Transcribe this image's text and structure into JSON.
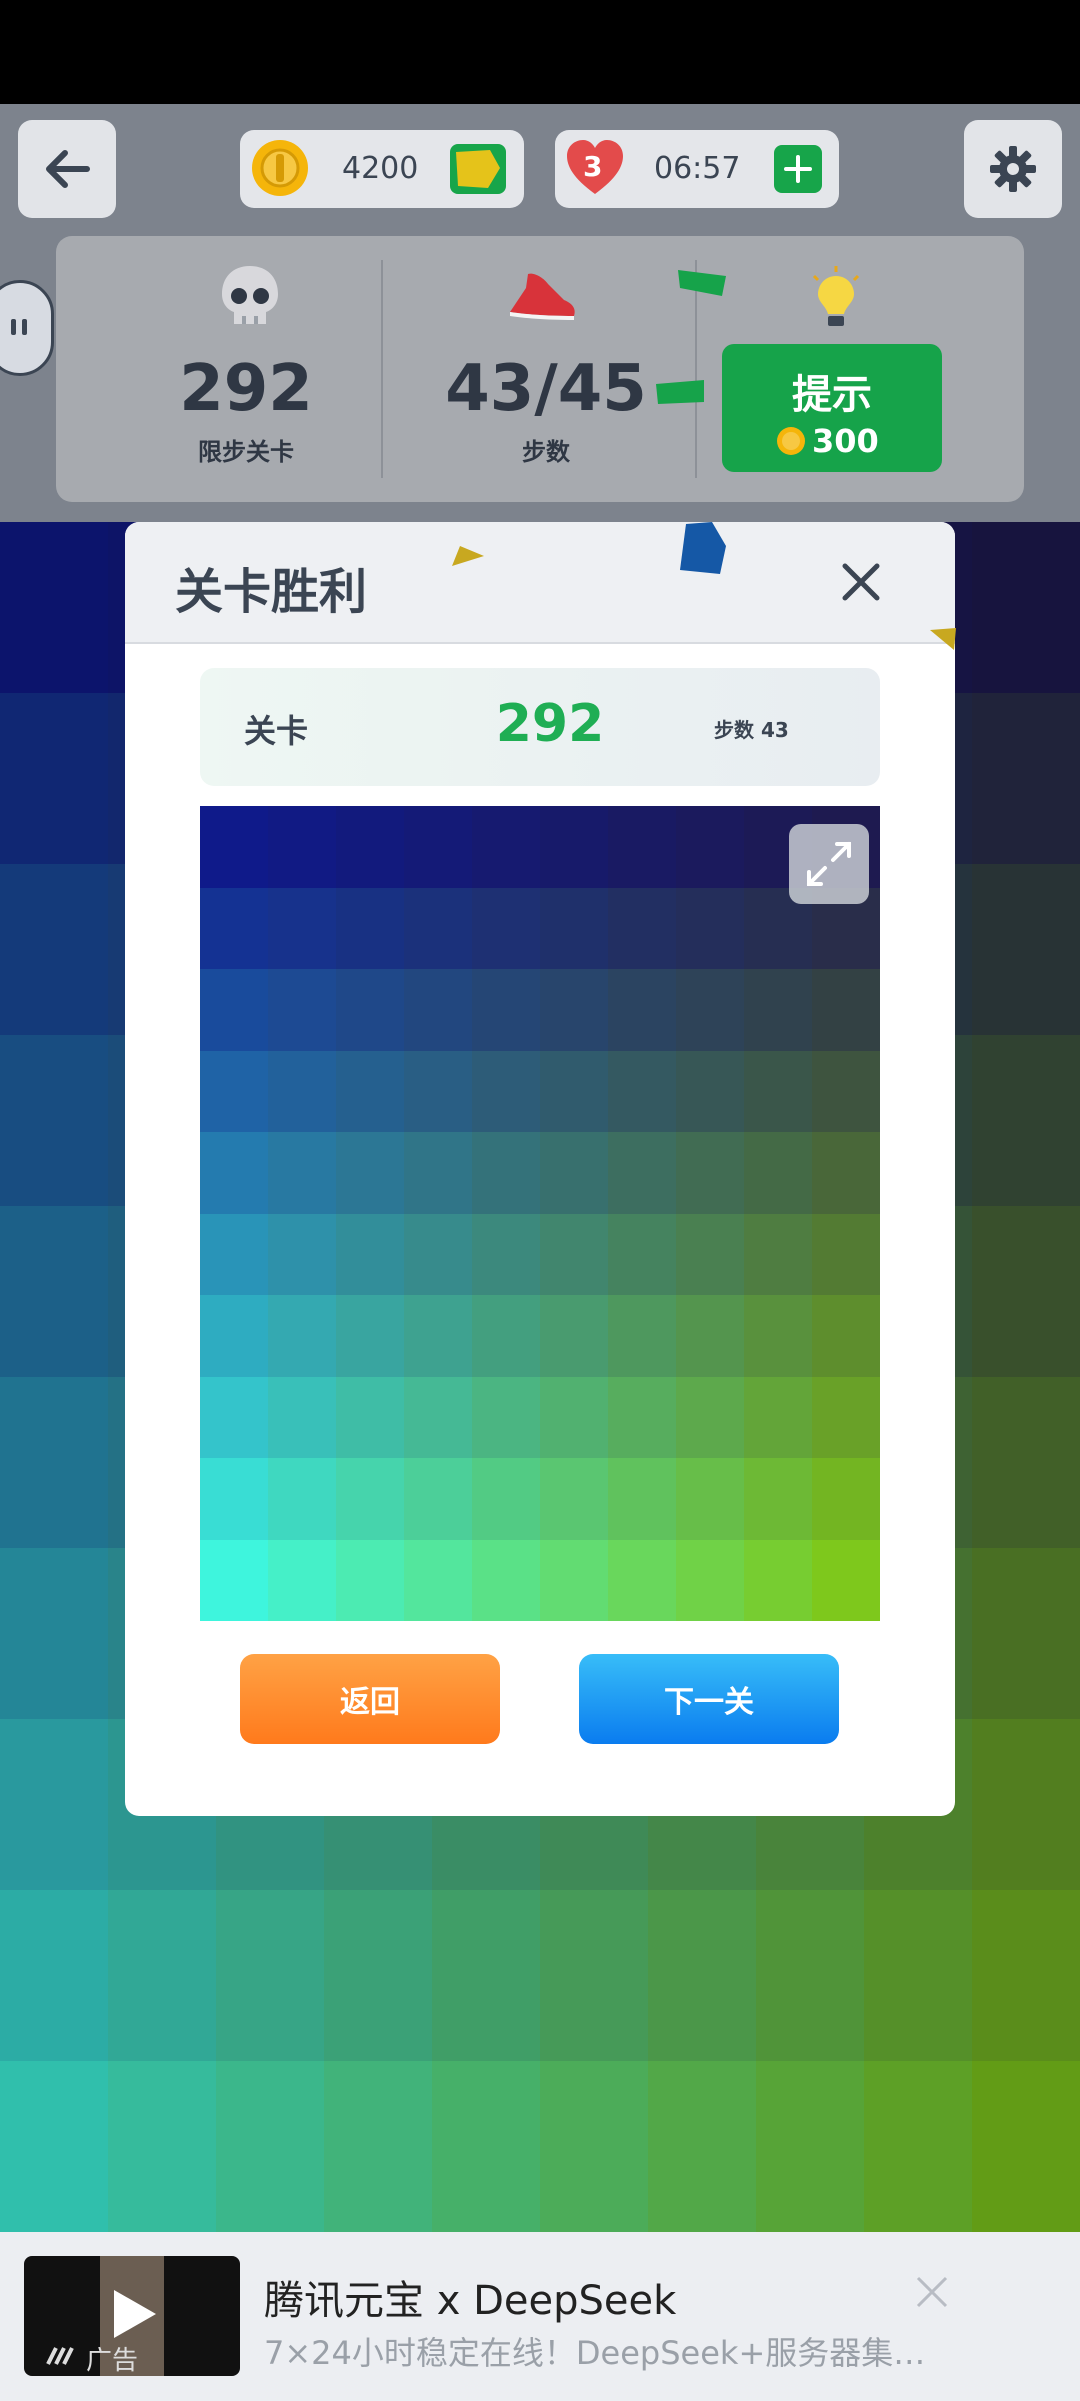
{
  "hud": {
    "coins": "4200",
    "lives": "3",
    "timer": "06:57"
  },
  "stats": {
    "level": "292",
    "level_label": "限步关卡",
    "steps": "43/45",
    "steps_label": "步数",
    "hint_label": "提示",
    "hint_cost": "300"
  },
  "modal": {
    "title": "关卡胜利",
    "level_label": "关卡",
    "level_value": "292",
    "steps_text": "步数 43",
    "back_label": "返回",
    "next_label": "下一关"
  },
  "colors": {
    "top_left": "#0f1a8a",
    "top_right": "#1e1a50",
    "bottom_left": "#3ef5dd",
    "bottom_right": "#7ec81c",
    "accent_green": "#16a34a",
    "back_orange": "#ff8a2a",
    "next_blue": "#1e90ff"
  },
  "ad": {
    "title": "腾讯元宝 x DeepSeek",
    "description": "7×24小时稳定在线！DeepSeek+服务器集…",
    "tag": "广告"
  }
}
